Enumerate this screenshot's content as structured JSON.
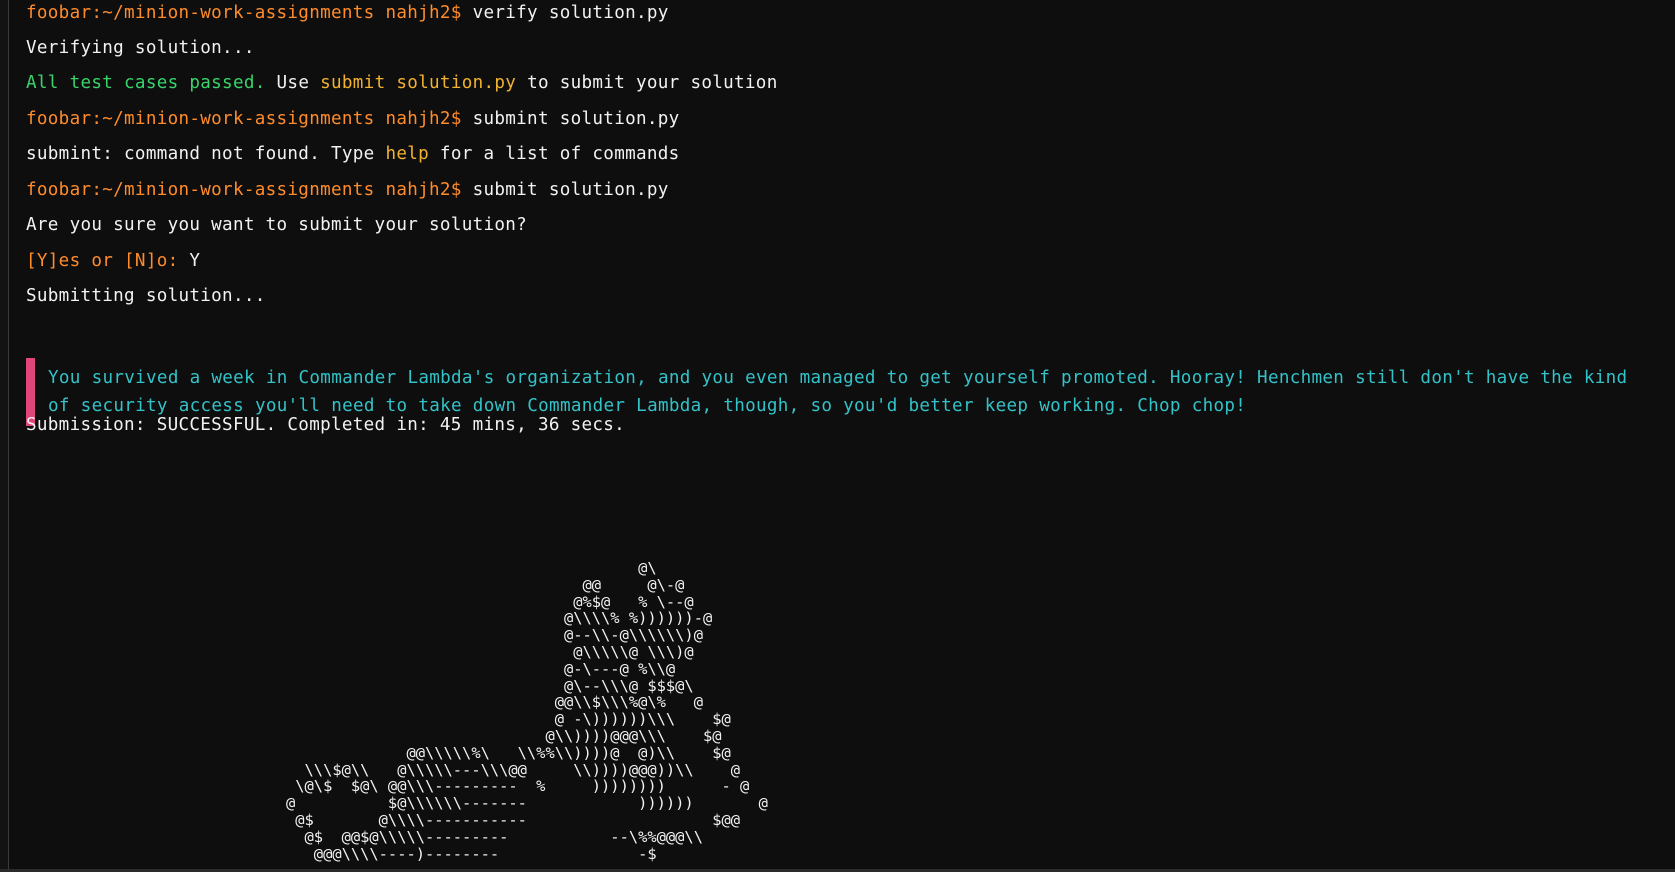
{
  "terminal": {
    "lines": [
      {
        "prompt": "foobar:~/minion-work-assignments nahjh2$",
        "command": " verify solution.py"
      },
      {
        "text": "Verifying solution..."
      },
      {
        "success": "All test cases passed.",
        "mid": " Use ",
        "highlight": "submit solution.py",
        "tail": " to submit your solution"
      },
      {
        "prompt": "foobar:~/minion-work-assignments nahjh2$",
        "command": " submint solution.py"
      },
      {
        "lead": "submint: command not found. Type ",
        "highlight": "help",
        "tail": " for a list of commands"
      },
      {
        "prompt": "foobar:~/minion-work-assignments nahjh2$",
        "command": " submit solution.py"
      },
      {
        "text": "Are you sure you want to submit your solution?"
      },
      {
        "question": "[Y]es or [N]o:",
        "answer": " Y"
      },
      {
        "text": "Submitting solution..."
      }
    ],
    "message": "You survived a week in Commander Lambda's organization, and you even managed to get yourself promoted. Hooray! Henchmen still don't have the kind of security access you'll need to take down Commander Lambda, though, so you'd better keep working. Chop chop!",
    "result": "Submission: SUCCESSFUL. Completed in: 45 mins, 36 secs.",
    "ascii_art": "                                      @\\\n                                @@     @\\-@\n                               @%$@   % \\--@\n                              @\\\\\\\\% %))))))-@\n                              @--\\\\-@\\\\\\\\\\\\)@\n                               @\\\\\\\\\\@ \\\\\\)@\n                              @-\\---@ %\\\\@\n                              @\\--\\\\\\@ $$$@\\\n                             @@\\\\$\\\\\\%@\\%   @\n                             @ -\\))))))\\\\\\    $@\n                            @\\\\))))@@@\\\\\\    $@\n             @@\\\\\\\\\\%\\   \\\\%%\\\\))))@  @)\\\\    $@\n  \\\\\\$@\\\\   @\\\\\\\\\\---\\\\\\@@     \\\\))))@@@))\\\\    @\n \\@\\$  $@\\ @@\\\\\\---------  %     ))))))))      - @\n@          $@\\\\\\\\\\\\-------            ))))))       @\n @$       @\\\\\\\\-----------                    $@@\n  @$  @@$@\\\\\\\\\\---------           --\\%%@@@\\\\\n   @@@\\\\\\\\----)--------               -$"
  }
}
